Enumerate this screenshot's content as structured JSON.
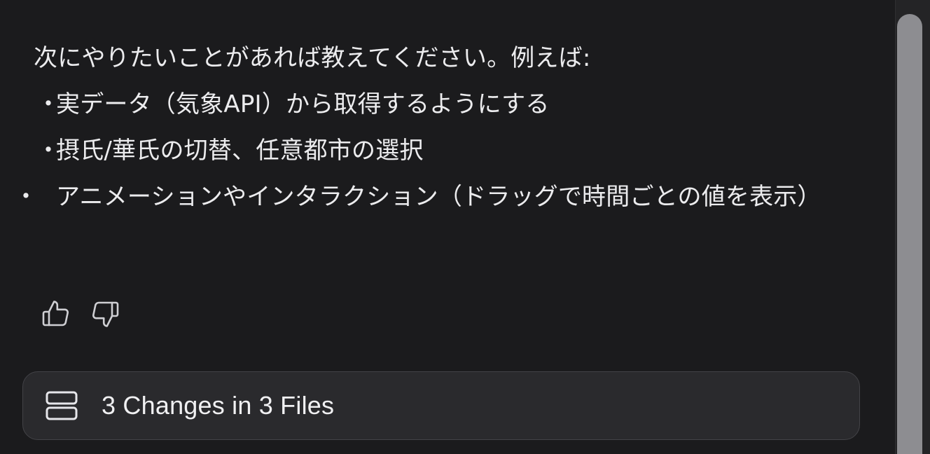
{
  "message": {
    "intro": "次にやりたいことがあれば教えてください。例えば:",
    "bullet_glyph": "・",
    "suggestions": [
      "実データ（気象API）から取得するようにする",
      "摂氏/華氏の切替、任意都市の選択",
      "アニメーションやインタラクション（ドラッグで時間ごとの値を表示）"
    ]
  },
  "feedback": {
    "thumbs_up_icon": "thumbs-up-icon",
    "thumbs_down_icon": "thumbs-down-icon"
  },
  "changes": {
    "icon": "file-stack-icon",
    "label": "3 Changes in 3 Files"
  },
  "colors": {
    "background": "#1b1b1d",
    "text": "#ececee",
    "bar_background": "#2a2a2d",
    "bar_border": "#434347",
    "scroll_thumb": "#8d8d91"
  }
}
